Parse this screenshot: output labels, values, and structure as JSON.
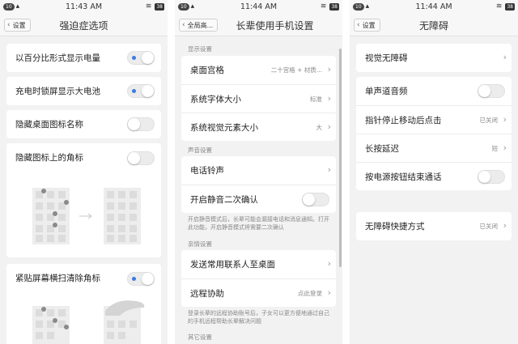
{
  "screens": [
    {
      "status": {
        "left_badge": "10",
        "time": "11:43 AM",
        "battery": "38"
      },
      "back_label": "设置",
      "title": "强迫症选项",
      "rows": [
        {
          "label": "以百分比形式显示电量",
          "toggle": true
        },
        {
          "label": "充电时锁屏显示大电池",
          "toggle": true
        },
        {
          "label": "隐藏桌面图标名称",
          "toggle": false
        },
        {
          "label": "隐藏图标上的角标",
          "toggle": false
        },
        {
          "label": "紧贴屏幕横扫清除角标",
          "toggle": true
        }
      ]
    },
    {
      "status": {
        "left_badge": "10",
        "time": "11:44 AM",
        "battery": "38"
      },
      "back_label": "全局高...",
      "title": "长辈使用手机设置",
      "sections": [
        {
          "title": "显示设置"
        },
        {
          "title": "声音设置"
        },
        {
          "title": "亲情设置"
        },
        {
          "title": "其它设置"
        }
      ],
      "rows": [
        {
          "label": "桌面宫格",
          "value": "二十宫格 + 材质..."
        },
        {
          "label": "系统字体大小",
          "value": "标准"
        },
        {
          "label": "系统视觉元素大小",
          "value": "大"
        },
        {
          "label": "电话铃声",
          "value": ""
        },
        {
          "label": "开启静音二次确认",
          "toggle": false
        },
        {
          "label": "发送常用联系人至桌面",
          "value": ""
        },
        {
          "label": "远程协助",
          "value": "点此登录"
        }
      ],
      "notes": {
        "mute": "开启静音模式后，长辈可能会漏接电话和消息通知。打开此功能，开启静音模式将需要二次确认",
        "remote": "登录长辈的远程协助账号后，子女可以更方便地通过自己的手机远程帮助长辈解决问题"
      }
    },
    {
      "status": {
        "left_badge": "10",
        "time": "11:44 AM",
        "battery": "38"
      },
      "back_label": "设置",
      "title": "无障碍",
      "rows": [
        {
          "label": "视觉无障碍",
          "value": ""
        },
        {
          "label": "单声道音频",
          "toggle": false
        },
        {
          "label": "指针停止移动后点击",
          "value": "已关闭"
        },
        {
          "label": "长按延迟",
          "value": "短"
        },
        {
          "label": "按电源按钮结束通话",
          "toggle": false
        },
        {
          "label": "无障碍快捷方式",
          "value": "已关闭"
        }
      ]
    }
  ],
  "icons": {
    "back": "chevron-left-icon",
    "arrow": "chevron-right-icon",
    "wifi": "wifi-icon",
    "signal": "signal-icon",
    "battery": "battery-icon"
  },
  "colors": {
    "background": "#f2f2f2",
    "card": "#ffffff",
    "toggle_on_dot": "#3b7ce0",
    "secondary_text": "#888888"
  }
}
